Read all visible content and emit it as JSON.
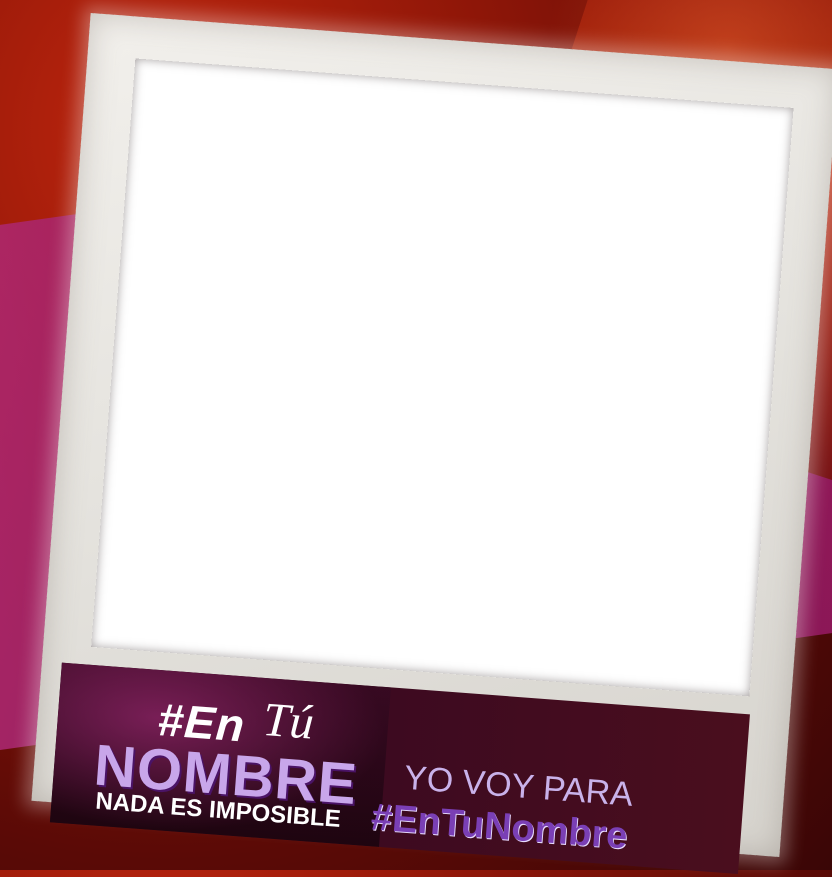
{
  "logo": {
    "hashtag": "#En",
    "tu": "Tú",
    "nombre": "NOMBRE",
    "tagline": "NADA ES IMPOSIBLE"
  },
  "slogan": {
    "line1": "YO VOY PARA",
    "line2": "#EnTuNombre"
  },
  "colors": {
    "accent_purple": "#7a3fb5",
    "light_purple": "#c9b2ea",
    "background_red": "#8e1608",
    "background_magenta": "#b21e7a"
  }
}
